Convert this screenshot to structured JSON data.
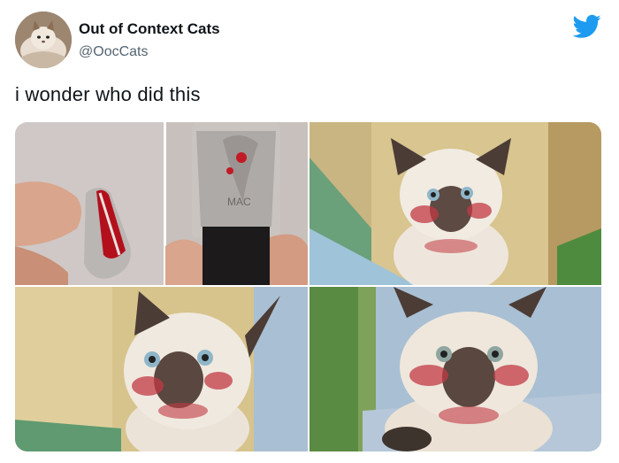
{
  "account": {
    "display_name": "Out of Context Cats",
    "handle": "@OocCats",
    "avatar_icon": "cat-avatar-icon",
    "platform_icon": "twitter-bird-icon",
    "brand_color": "#1d9bf0"
  },
  "tweet": {
    "text": "i wonder who did this"
  },
  "media": {
    "images": [
      {
        "name": "lipstick-photo",
        "layout": "top-left"
      },
      {
        "name": "cat-photo-1",
        "layout": "top-right"
      },
      {
        "name": "cat-photo-2",
        "layout": "bottom-left"
      },
      {
        "name": "cat-photo-3",
        "layout": "bottom-right"
      }
    ]
  }
}
